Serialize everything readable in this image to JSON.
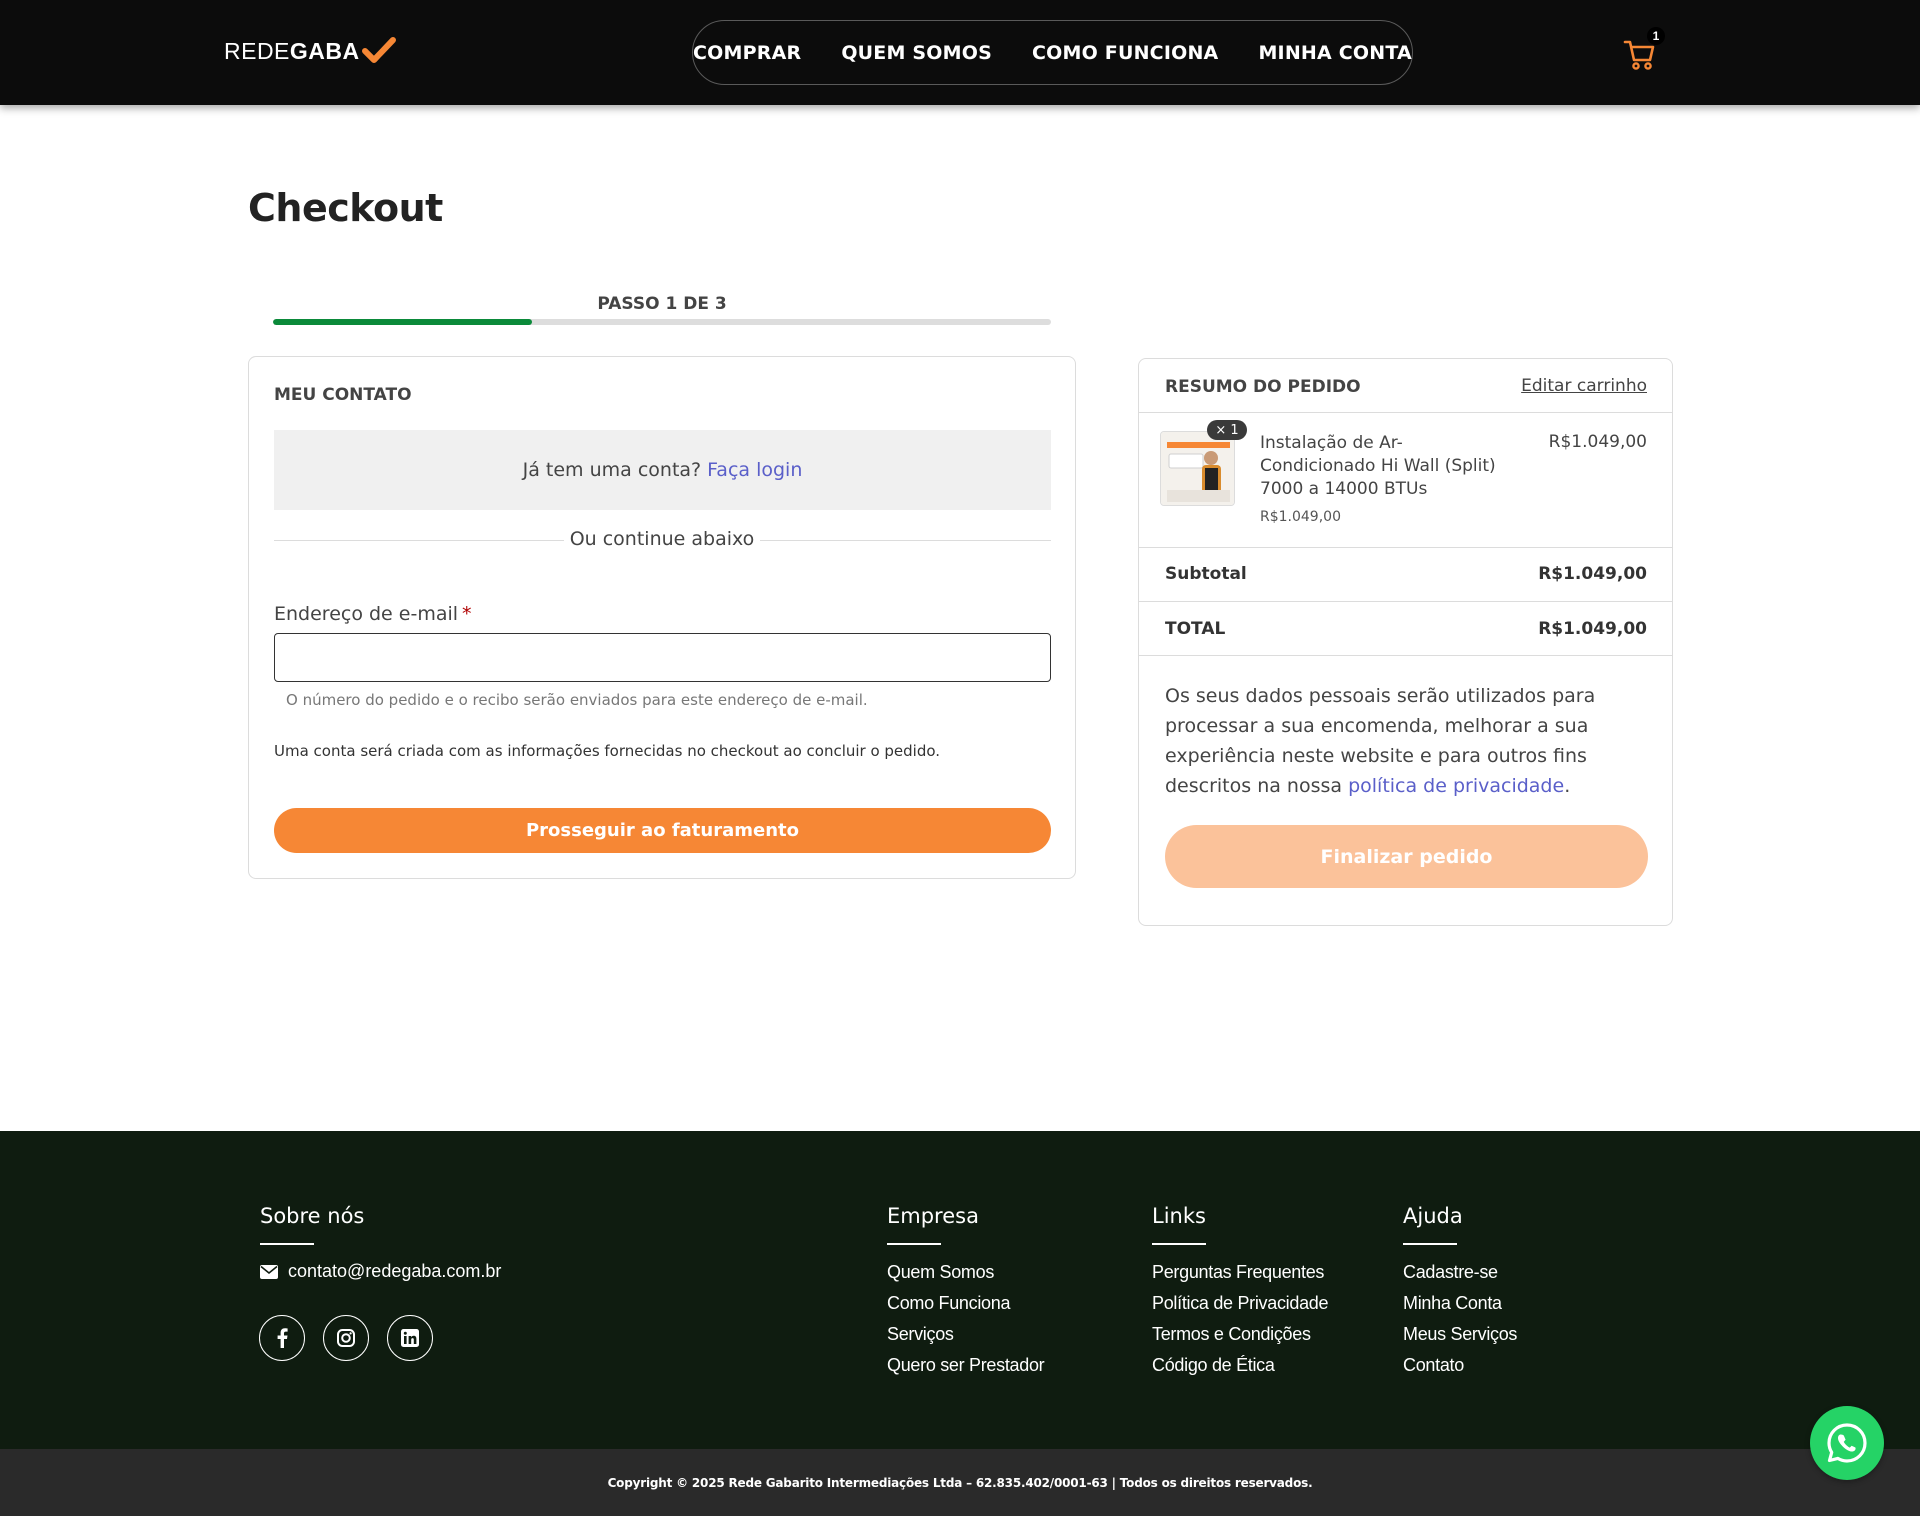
{
  "header": {
    "logo_part1": "REDE",
    "logo_part2": "GABA",
    "nav": [
      "COMPRAR",
      "QUEM SOMOS",
      "COMO FUNCIONA",
      "MINHA CONTA"
    ],
    "cart_count": "1",
    "accent_color": "#f68735"
  },
  "checkout": {
    "title": "Checkout",
    "step_label": "PASSO 1 DE 3",
    "step_progress": 0.333
  },
  "contact": {
    "section_title": "MEU CONTATO",
    "login_question": "Já tem uma conta?",
    "login_link": "Faça login",
    "divider_text": "Ou continue abaixo",
    "email_label": "Endereço de e-mail",
    "email_required_mark": "*",
    "email_value": "",
    "email_help": "O número do pedido e o recibo serão enviados para este endereço de e-mail.",
    "account_note": "Uma conta será criada com as informações fornecidas no checkout ao concluir o pedido.",
    "proceed_button": "Prosseguir ao faturamento"
  },
  "summary": {
    "title": "RESUMO DO PEDIDO",
    "edit_link": "Editar carrinho",
    "item": {
      "quantity": "× 1",
      "name": "Instalação de Ar-Condicionado Hi Wall (Split) 7000 a 14000 BTUs",
      "unit_price": "R$1.049,00",
      "price": "R$1.049,00"
    },
    "subtotal_label": "Subtotal",
    "subtotal_value": "R$1.049,00",
    "total_label": "TOTAL",
    "total_value": "R$1.049,00",
    "privacy_text": "Os seus dados pessoais serão utilizados para processar a sua encomenda, melhorar a sua experiência neste website e para outros fins descritos na nossa ",
    "privacy_link": "política de privacidade",
    "privacy_end": ".",
    "finish_button": "Finalizar pedido"
  },
  "footer": {
    "about_title": "Sobre nós",
    "email": "contato@redegaba.com.br",
    "social_icons": [
      "facebook-icon",
      "instagram-icon",
      "linkedin-icon"
    ],
    "columns": [
      {
        "title": "Empresa",
        "links": [
          "Quem Somos",
          "Como Funciona",
          "Serviços",
          "Quero ser Prestador"
        ]
      },
      {
        "title": "Links",
        "links": [
          "Perguntas Frequentes",
          "Política de Privacidade",
          "Termos e Condições",
          "Código de Ética"
        ]
      },
      {
        "title": "Ajuda",
        "links": [
          "Cadastre-se",
          "Minha Conta",
          "Meus Serviços",
          "Contato"
        ]
      }
    ],
    "copyright": "Copyright © 2025 Rede Gabarito Intermediações Ltda – 62.835.402/0001-63 | Todos os direitos reservados."
  }
}
